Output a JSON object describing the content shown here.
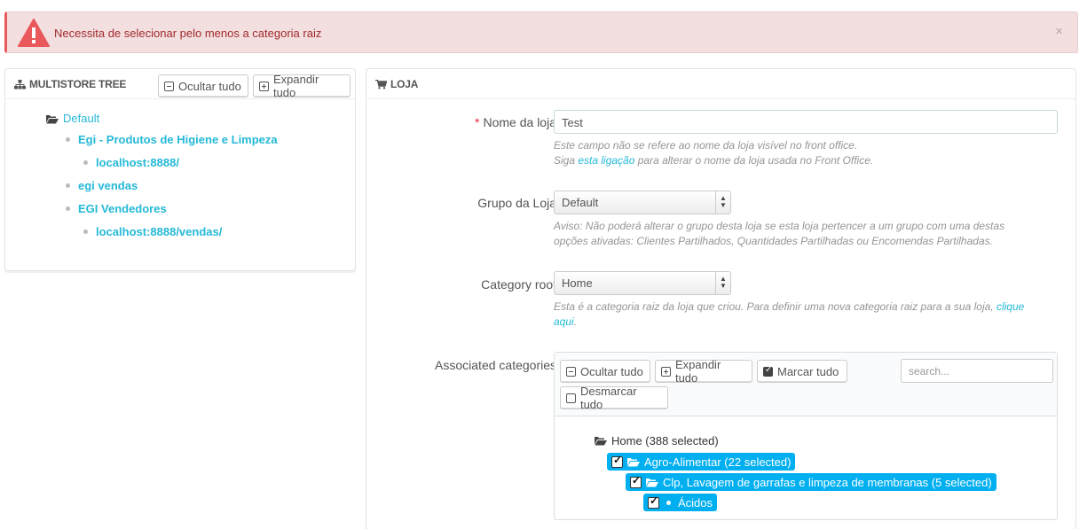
{
  "alert": {
    "message": "Necessita de selecionar pelo menos a categoria raiz",
    "close": "×"
  },
  "multistore": {
    "title": "MULTISTORE TREE",
    "collapse_label": "Ocultar tudo",
    "expand_label": "Expandir tudo",
    "tree": [
      {
        "label": "Default"
      },
      {
        "label": "Egi - Produtos de Higiene e Limpeza"
      },
      {
        "label": "localhost:8888/"
      },
      {
        "label": "egi vendas"
      },
      {
        "label": "EGI Vendedores"
      },
      {
        "label": "localhost:8888/vendas/"
      }
    ]
  },
  "shop": {
    "title": "LOJA",
    "name_label": "Nome da loja",
    "name_required": "*",
    "name_value": "Test",
    "name_help_1": "Este campo não se refere ao nome da loja visível no front office.",
    "name_help_2_pre": "Siga ",
    "name_help_2_link": "esta ligação",
    "name_help_2_post": " para alterar o nome da loja usada no Front Office.",
    "group_label": "Grupo da Loja",
    "group_value": "Default",
    "group_help_1": "Aviso: Não poderá alterar o grupo desta loja se esta loja pertencer a um grupo com uma destas",
    "group_help_2": "opções ativadas: Clientes Partilhados, Quantidades Partilhadas ou Encomendas Partilhadas.",
    "root_label": "Category root",
    "root_value": "Home",
    "root_help_1_pre": "Esta é a categoria raiz da loja que criou. Para definir uma nova categoria raiz para a sua loja, ",
    "root_help_1_link": "clique",
    "root_help_2_link": "aqui",
    "root_help_2_post": ".",
    "assoc_label": "Associated categories"
  },
  "categories": {
    "collapse_label": "Ocultar tudo",
    "expand_label": "Expandir tudo",
    "check_all_label": "Marcar tudo",
    "uncheck_all_label": "Desmarcar tudo",
    "search_placeholder": "search...",
    "tree": [
      {
        "label": "Home (388 selected)",
        "selected": false
      },
      {
        "label": "Agro-Alimentar (22 selected)",
        "selected": true
      },
      {
        "label": "Clp, Lavagem de garrafas e limpeza de membranas (5 selected)",
        "selected": true
      },
      {
        "label": "Ácidos",
        "selected": true
      }
    ]
  },
  "colors": {
    "accent": "#25b9d7",
    "selected_bg": "#00aff0",
    "alert_bg": "#f3dfe0",
    "alert_text": "#a12a2d",
    "required": "#e3283e"
  },
  "icons": [
    "warning-icon",
    "sitemap-icon",
    "cart-icon",
    "folder-open-icon",
    "minus-square-icon",
    "plus-square-icon",
    "check-square-icon",
    "square-icon",
    "close-icon"
  ]
}
